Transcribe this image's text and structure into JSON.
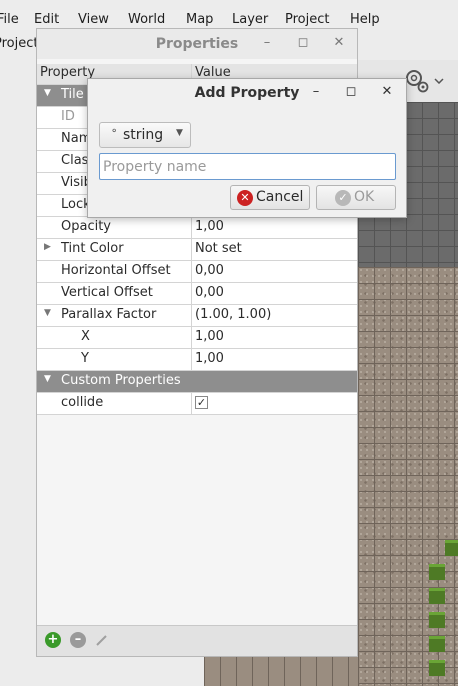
{
  "menubar": {
    "items": [
      "File",
      "Edit",
      "View",
      "World",
      "Map",
      "Layer",
      "Project",
      "Help"
    ]
  },
  "sidebar": {
    "label": "Project"
  },
  "properties_window": {
    "title": "Properties",
    "headers": {
      "property": "Property",
      "value": "Value"
    },
    "group_tile": "Tile",
    "rows_partial": [
      "ID",
      "Name",
      "Class",
      "Visible",
      "Locked",
      "Opacity"
    ],
    "opacity_value": "1,00",
    "rows": [
      {
        "name": "Tint Color",
        "value": "Not set"
      },
      {
        "name": "Horizontal Offset",
        "value": "0,00"
      },
      {
        "name": "Vertical Offset",
        "value": "0,00"
      },
      {
        "name": "Parallax Factor",
        "value": "(1.00, 1.00)"
      },
      {
        "name": "X",
        "value": "1,00"
      },
      {
        "name": "Y",
        "value": "1,00"
      }
    ],
    "custom_group": "Custom Properties",
    "custom_rows": [
      {
        "name": "collide",
        "value": "✓"
      }
    ],
    "footer_icons": [
      "add-icon",
      "remove-icon",
      "rename-icon"
    ]
  },
  "add_property_dialog": {
    "title": "Add Property",
    "type_select": {
      "value": "string"
    },
    "name_input": {
      "value": "",
      "placeholder": "Property name"
    },
    "cancel_label": "Cancel",
    "ok_label": "OK"
  },
  "colors": {
    "accent": "#6a9ad0",
    "group_header": "#8e8e8e",
    "add_green": "#3a9a2a",
    "cancel_red": "#cc2222"
  }
}
